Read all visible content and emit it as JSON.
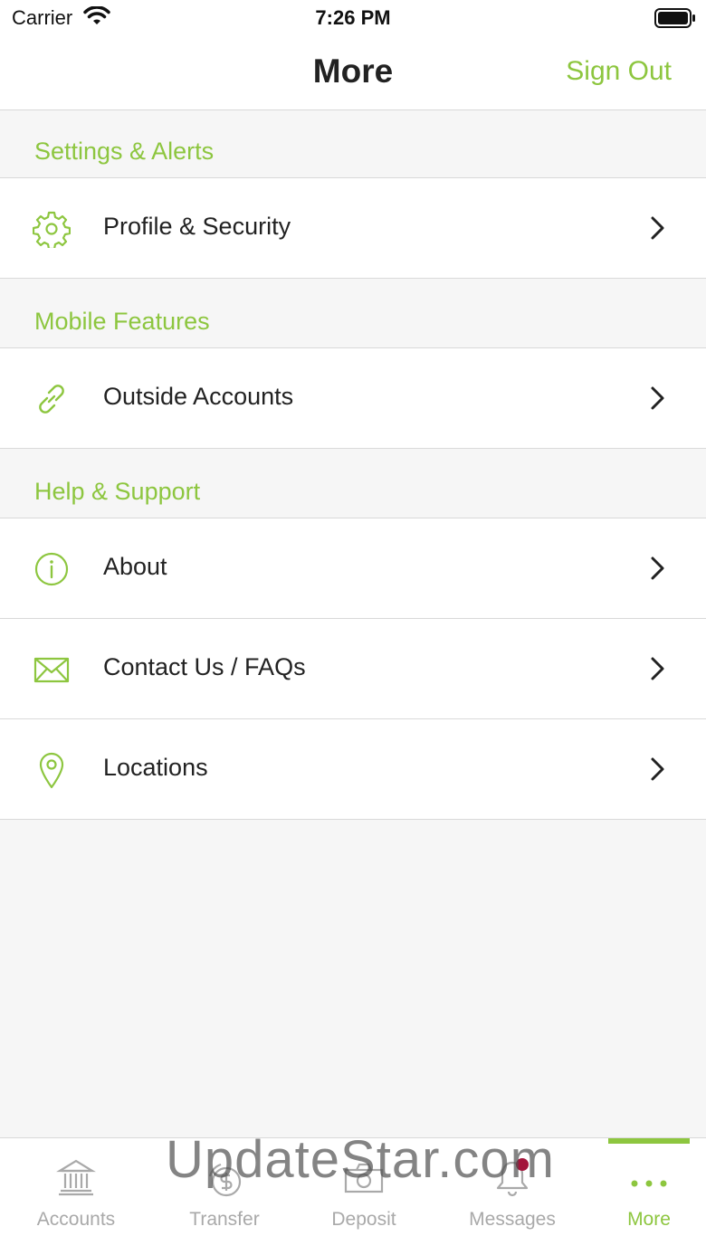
{
  "status": {
    "carrier": "Carrier",
    "time": "7:26 PM"
  },
  "nav": {
    "title": "More",
    "sign_out": "Sign Out"
  },
  "sections": [
    {
      "header": "Settings & Alerts",
      "items": [
        {
          "label": "Profile & Security",
          "icon": "gear-icon"
        }
      ]
    },
    {
      "header": "Mobile Features",
      "items": [
        {
          "label": "Outside Accounts",
          "icon": "link-icon"
        }
      ]
    },
    {
      "header": "Help & Support",
      "items": [
        {
          "label": "About",
          "icon": "info-icon"
        },
        {
          "label": "Contact Us / FAQs",
          "icon": "envelope-icon"
        },
        {
          "label": "Locations",
          "icon": "location-pin-icon"
        }
      ]
    }
  ],
  "tabs": [
    {
      "label": "Accounts",
      "icon": "bank-icon"
    },
    {
      "label": "Transfer",
      "icon": "dollar-transfer-icon"
    },
    {
      "label": "Deposit",
      "icon": "camera-icon"
    },
    {
      "label": "Messages",
      "icon": "bell-icon"
    },
    {
      "label": "More",
      "icon": "more-dots-icon",
      "active": true
    }
  ],
  "watermark": "UpdateStar.com",
  "colors": {
    "accent": "#8dc63f",
    "badge": "#a3143a",
    "inactive_tab": "#a9a9a9"
  }
}
